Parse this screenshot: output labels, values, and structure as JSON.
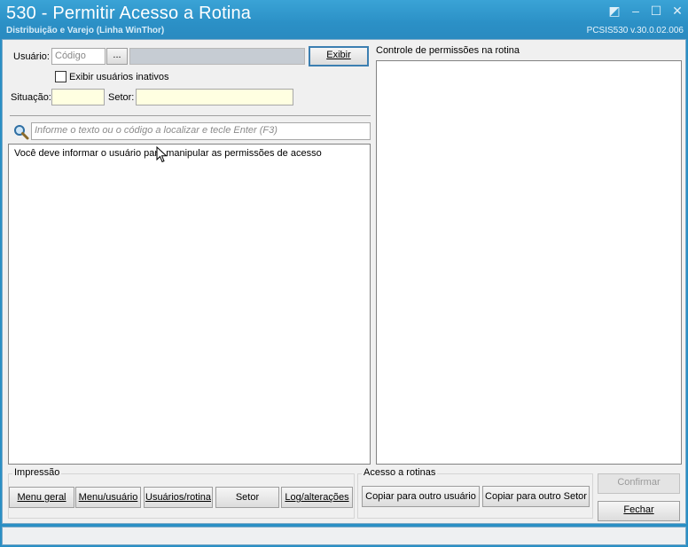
{
  "window": {
    "title": "530 - Permitir Acesso a Rotina",
    "subtitle": "Distribuição e Varejo (Linha WinThor)",
    "version": "PCSIS530  v.30.0.02.006",
    "controls": {
      "restore": "◩",
      "minimize": "–",
      "maximize": "☐",
      "close": "✕"
    }
  },
  "form": {
    "usuario_label": "Usuário:",
    "codigo_placeholder": "Código",
    "browse_label": "...",
    "exibir_label": "Exibir",
    "inativos_label": "Exibir usuários inativos",
    "situacao_label": "Situação:",
    "setor_label": "Setor:"
  },
  "search": {
    "placeholder": "Informe o texto ou o código a localizar e tecle Enter (F3)"
  },
  "list": {
    "message": "Você deve informar o usuário para manipular as permissões de acesso"
  },
  "permissions": {
    "title": "Controle de permissões na rotina"
  },
  "impressao": {
    "title": "Impressão",
    "buttons": [
      "Menu geral",
      "Menu/usuário",
      "Usuários/rotina",
      "Setor",
      "Log/alterações"
    ]
  },
  "acesso": {
    "title": "Acesso a rotinas",
    "copy_user": "Copiar para outro usuário",
    "copy_setor": "Copiar para outro Setor"
  },
  "actions": {
    "confirmar": "Confirmar",
    "fechar": "Fechar"
  },
  "colors": {
    "titlebar": "#2a8fc4",
    "yellow_field": "#ffffe1",
    "accent_border": "#3c7fb1"
  }
}
